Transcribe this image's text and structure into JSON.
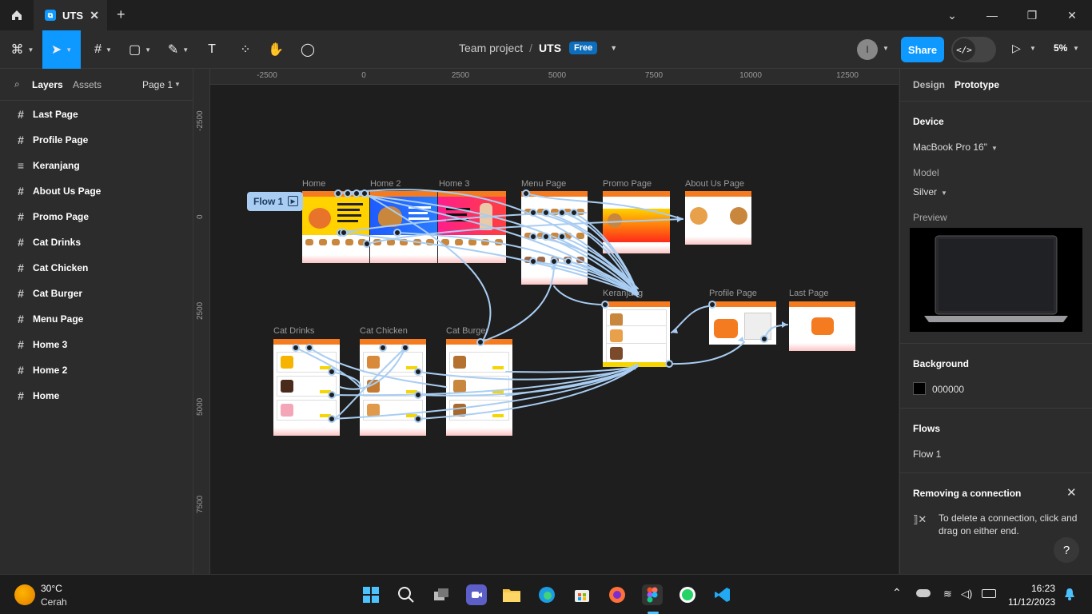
{
  "titlebar": {
    "tab_title": "UTS",
    "tab_icon_glyph": "⧉",
    "new_tab_glyph": "+",
    "min_glyph": "—",
    "max_glyph": "❐",
    "close_glyph": "✕",
    "chevron_glyph": "⌄"
  },
  "toolbar": {
    "project": "Team project",
    "separator": "/",
    "file": "UTS",
    "plan_badge": "Free",
    "avatar_letter": "I",
    "share_label": "Share",
    "devmode_glyph": "</>",
    "present_glyph": "▷",
    "zoom": "5%",
    "tools": {
      "main_menu": "⌘",
      "move": "➤",
      "frame": "#",
      "shape": "▢",
      "pen": "✎",
      "text": "T",
      "resources": "⁘",
      "hand": "✋",
      "comment": "◯"
    }
  },
  "left_panel": {
    "search_glyph": "⌕",
    "tab_layers": "Layers",
    "tab_assets": "Assets",
    "page_selector": "Page 1",
    "layers": [
      {
        "label": "Last Page",
        "icon": "#"
      },
      {
        "label": "Profile Page",
        "icon": "#"
      },
      {
        "label": "Keranjang",
        "icon": "≡"
      },
      {
        "label": "About Us Page",
        "icon": "#"
      },
      {
        "label": "Promo Page",
        "icon": "#"
      },
      {
        "label": "Cat Drinks",
        "icon": "#"
      },
      {
        "label": "Cat Chicken",
        "icon": "#"
      },
      {
        "label": "Cat Burger",
        "icon": "#"
      },
      {
        "label": "Menu Page",
        "icon": "#"
      },
      {
        "label": "Home 3",
        "icon": "#"
      },
      {
        "label": "Home 2",
        "icon": "#"
      },
      {
        "label": "Home",
        "icon": "#"
      }
    ]
  },
  "rulers": {
    "top": [
      "-2500",
      "0",
      "2500",
      "5000",
      "7500",
      "10000",
      "12500"
    ],
    "left": [
      "-2500",
      "0",
      "2500",
      "5000",
      "7500"
    ]
  },
  "canvas": {
    "flow_tag": "Flow 1",
    "frames": {
      "home": "Home",
      "home2": "Home 2",
      "home3": "Home 3",
      "menu": "Menu Page",
      "promo": "Promo Page",
      "about": "About Us Page",
      "keranjang": "Keranjang",
      "profile": "Profile Page",
      "last": "Last Page",
      "drinks": "Cat Drinks",
      "chicken": "Cat Chicken",
      "burger": "Cat Burger"
    },
    "wire_color": "#a9cdf2"
  },
  "right_panel": {
    "tab_design": "Design",
    "tab_prototype": "Prototype",
    "device_title": "Device",
    "device_value": "MacBook Pro 16\"",
    "model_label": "Model",
    "model_value": "Silver",
    "preview_label": "Preview",
    "background_title": "Background",
    "background_hex": "000000",
    "background_color": "#000000",
    "flows_title": "Flows",
    "flow_item": "Flow 1",
    "removing_title": "Removing a connection",
    "removing_text": "To delete a connection, click and drag on either end.",
    "help_glyph": "?"
  },
  "taskbar": {
    "temperature": "30°C",
    "weather": "Cerah",
    "time": "16:23",
    "date": "11/12/2023",
    "tray_up": "⌃"
  }
}
